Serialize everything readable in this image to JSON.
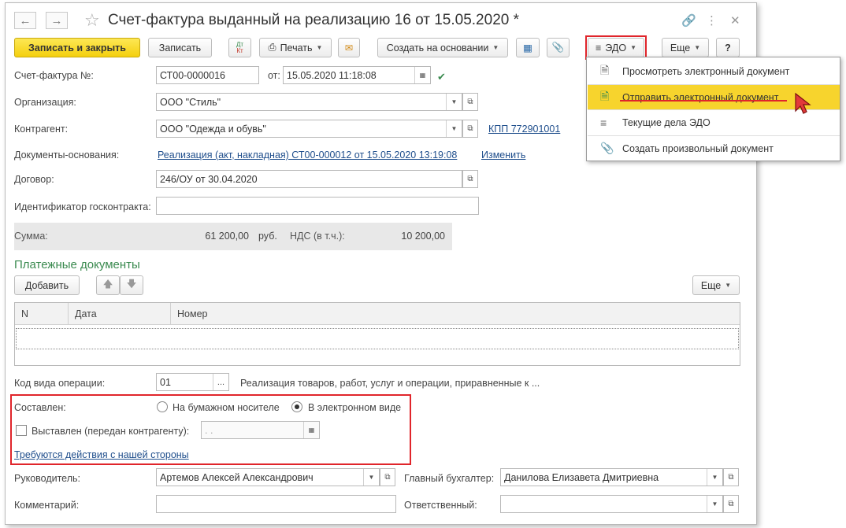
{
  "window": {
    "title": "Счет-фактура выданный на реализацию 16 от 15.05.2020 *",
    "back_icon": "arrow-left",
    "forward_icon": "arrow-right"
  },
  "toolbar": {
    "save_close": "Записать и закрыть",
    "save": "Записать",
    "dt_kt": "Дт Кт",
    "print": "Печать",
    "create_based": "Создать на основании",
    "edo": "ЭДО",
    "more": "Еще",
    "help": "?"
  },
  "form": {
    "invoice_label": "Счет-фактура №:",
    "invoice_value": "СТ00-0000016",
    "from_label": "от:",
    "date_value": "15.05.2020 11:18:08",
    "org_label": "Организация:",
    "org_value": "ООО \"Стиль\"",
    "contractor_label": "Контрагент:",
    "contractor_value": "ООО \"Одежда и обувь\"",
    "kpp_link": "КПП 772901001",
    "base_docs_label": "Документы-основания:",
    "base_docs_link": "Реализация (акт, накладная) СТ00-000012 от 15.05.2020 13:19:08",
    "change_link": "Изменить",
    "contract_label": "Договор:",
    "contract_value": "246/ОУ от 30.04.2020",
    "gov_contract_label": "Идентификатор госконтракта:",
    "gov_contract_value": "",
    "sum_label": "Сумма:",
    "sum_value": "61 200,00",
    "currency": "руб.",
    "vat_label": "НДС (в т.ч.):",
    "vat_value": "10 200,00"
  },
  "payments": {
    "title": "Платежные документы",
    "add_button": "Добавить",
    "more": "Еще",
    "columns": [
      "N",
      "Дата",
      "Номер"
    ],
    "rows": []
  },
  "operation": {
    "code_label": "Код вида операции:",
    "code_value": "01",
    "code_desc": "Реализация товаров, работ, услуг и операции, приравненные к ...",
    "compiled_label": "Составлен:",
    "paper_option": "На бумажном носителе",
    "electronic_option": "В электронном виде",
    "issued_label": "Выставлен (передан контрагенту):",
    "issued_date": ". .",
    "actions_link": "Требуются действия с нашей стороны"
  },
  "signatures": {
    "head_label": "Руководитель:",
    "head_value": "Артемов Алексей Александрович",
    "accountant_label": "Главный бухгалтер:",
    "accountant_value": "Данилова Елизавета Дмитриевна",
    "comment_label": "Комментарий:",
    "comment_value": "",
    "responsible_label": "Ответственный:",
    "responsible_value": ""
  },
  "edo_menu": {
    "items": [
      {
        "label": "Просмотреть электронный документ",
        "icon": "document-icon"
      },
      {
        "label": "Отправить электронный документ",
        "icon": "send-document-icon"
      },
      {
        "label": "Текущие дела ЭДО",
        "icon": "edo-tasks-icon"
      },
      {
        "label": "Создать произвольный документ",
        "icon": "paperclip-icon"
      }
    ]
  },
  "colors": {
    "accent_yellow": "#f4cf0e",
    "highlight": "#f7d42d",
    "annotation_red": "#e0252b",
    "link": "#1f4e8c",
    "section_green": "#3a8a4f"
  }
}
